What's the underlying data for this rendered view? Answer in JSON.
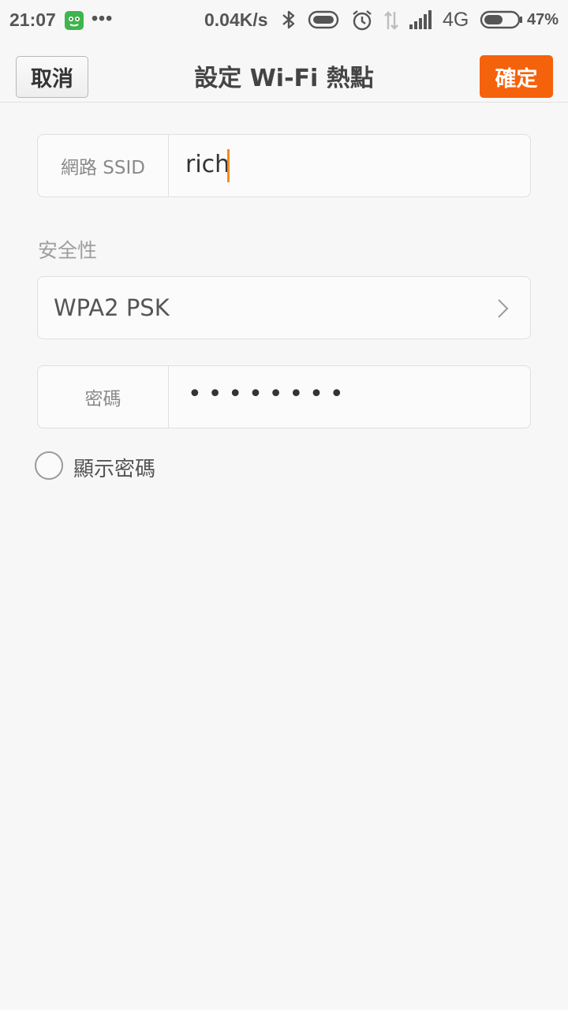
{
  "status_bar": {
    "time": "21:07",
    "dots": "•••",
    "net_speed": "0.04K/s",
    "network": "4G",
    "battery": "47%",
    "icons": [
      "app-notification-icon",
      "bluetooth-icon",
      "battery-saver-icon",
      "alarm-icon",
      "data-arrows-icon",
      "signal-icon",
      "battery-icon"
    ]
  },
  "header": {
    "cancel_label": "取消",
    "title": "設定 Wi-Fi 熱點",
    "confirm_label": "確定",
    "accent_color": "#f5620c"
  },
  "form": {
    "ssid": {
      "label": "網路 SSID",
      "value": "rich"
    },
    "security": {
      "section_label": "安全性",
      "value": "WPA2 PSK"
    },
    "password": {
      "label": "密碼",
      "masked_value": "••••••••"
    },
    "show_password": {
      "label": "顯示密碼",
      "checked": false
    }
  }
}
